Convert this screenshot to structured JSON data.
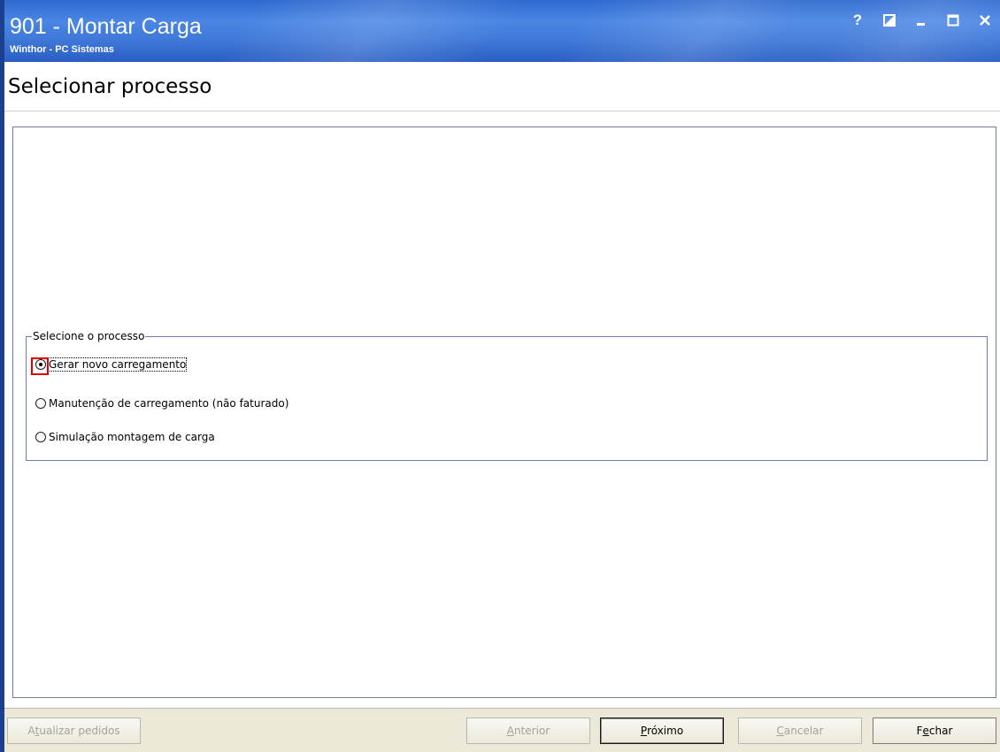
{
  "window": {
    "title": "901 - Montar Carga",
    "subtitle": "Winthor - PC Sistemas",
    "controls": [
      {
        "name": "help-icon",
        "glyph": "?"
      },
      {
        "name": "restore-panel-icon",
        "glyph": "◩"
      },
      {
        "name": "minimize-icon",
        "glyph": "_"
      },
      {
        "name": "maximize-icon",
        "glyph": "□"
      },
      {
        "name": "close-icon",
        "glyph": "X"
      }
    ]
  },
  "header": {
    "title": "Selecionar processo"
  },
  "process_group": {
    "legend": "Selecione o processo",
    "options": [
      {
        "label": "Gerar novo carregamento",
        "checked": true
      },
      {
        "label": "Manutenção de carregamento (não faturado)",
        "checked": false
      },
      {
        "label": "Simulação montagem de carga",
        "checked": false
      }
    ]
  },
  "footer": {
    "refresh": {
      "pre": "A",
      "ul": "t",
      "post": "ualizar pedidos",
      "enabled": false
    },
    "previous": {
      "pre": "",
      "ul": "A",
      "post": "nterior",
      "enabled": false
    },
    "next": {
      "pre": "",
      "ul": "P",
      "post": "róximo",
      "enabled": true
    },
    "cancel": {
      "pre": "",
      "ul": "C",
      "post": "ancelar",
      "enabled": false
    },
    "close": {
      "pre": "F",
      "ul": "e",
      "post": "char",
      "enabled": true
    }
  },
  "colors": {
    "titlebar": "#3f78d8",
    "highlight": "#e00000",
    "footer_bg": "#ece9d8",
    "group_border": "#6a7fb0"
  }
}
